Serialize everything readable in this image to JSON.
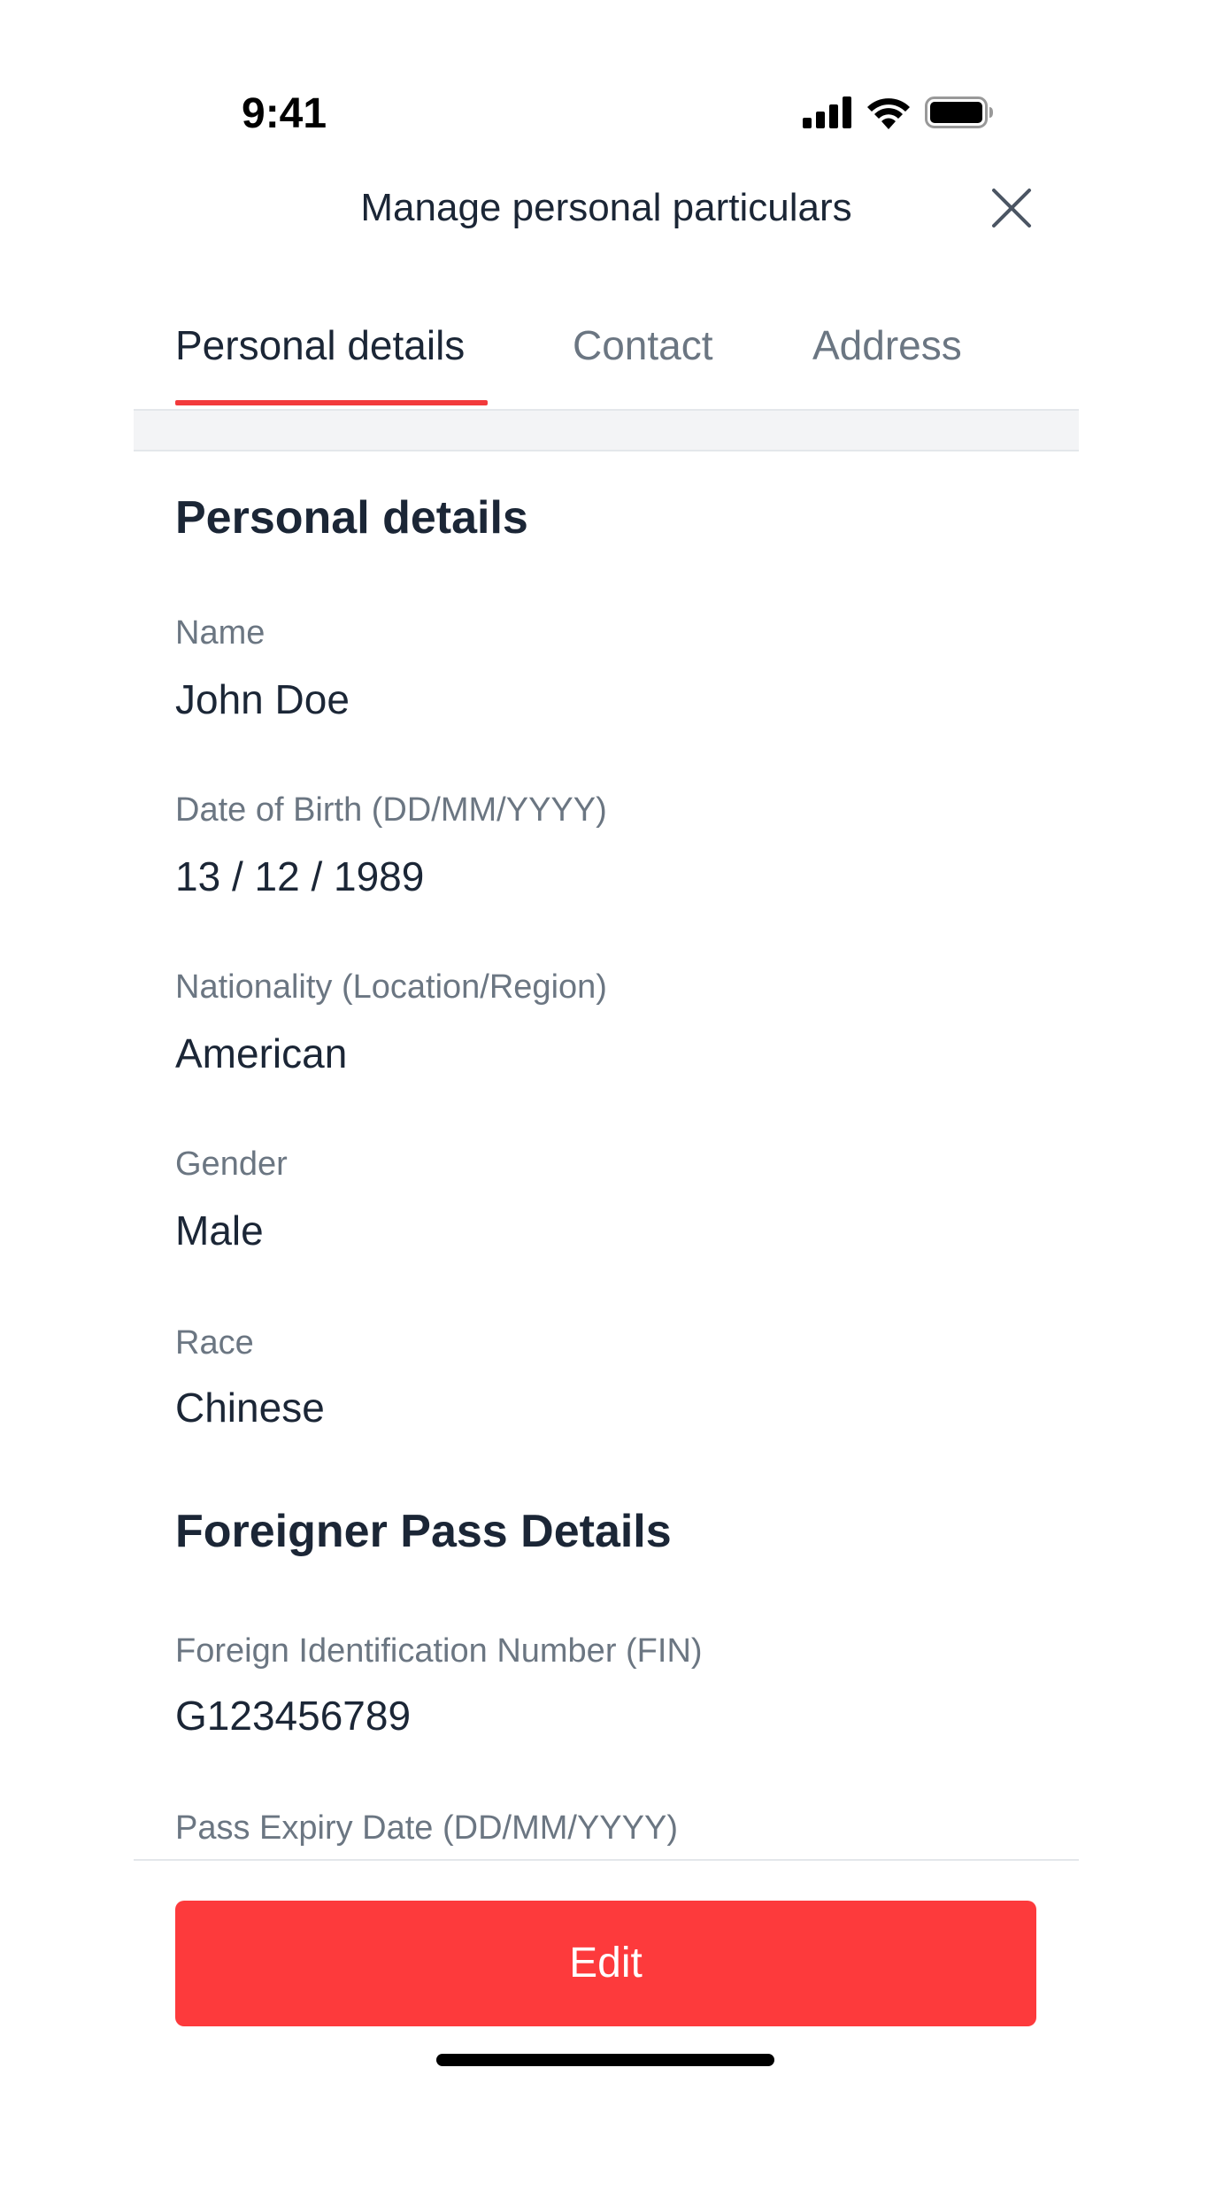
{
  "status_bar": {
    "time": "9:41",
    "icons": [
      "cellular-signal-icon",
      "wifi-icon",
      "battery-icon"
    ]
  },
  "header": {
    "title": "Manage personal particulars",
    "close_icon": "close-icon"
  },
  "tabs": [
    {
      "label": "Personal details",
      "active": true
    },
    {
      "label": "Contact",
      "active": false
    },
    {
      "label": "Address",
      "active": false
    }
  ],
  "sections": {
    "personal": {
      "title": "Personal details",
      "fields": [
        {
          "label": "Name",
          "value": "John Doe"
        },
        {
          "label": "Date of Birth (DD/MM/YYYY)",
          "value": "13 / 12 / 1989"
        },
        {
          "label": "Nationality (Location/Region)",
          "value": "American"
        },
        {
          "label": "Gender",
          "value": "Male"
        },
        {
          "label": "Race",
          "value": "Chinese"
        }
      ]
    },
    "foreigner_pass": {
      "title": "Foreigner Pass Details",
      "fields": [
        {
          "label": "Foreign Identification Number (FIN)",
          "value": "G123456789"
        },
        {
          "label": "Pass Expiry Date (DD/MM/YYYY)",
          "value": ""
        }
      ]
    }
  },
  "actions": {
    "edit_label": "Edit"
  },
  "colors": {
    "accent": "#fd3a3c",
    "text_primary": "#1b2636",
    "text_secondary": "#6b7682"
  }
}
